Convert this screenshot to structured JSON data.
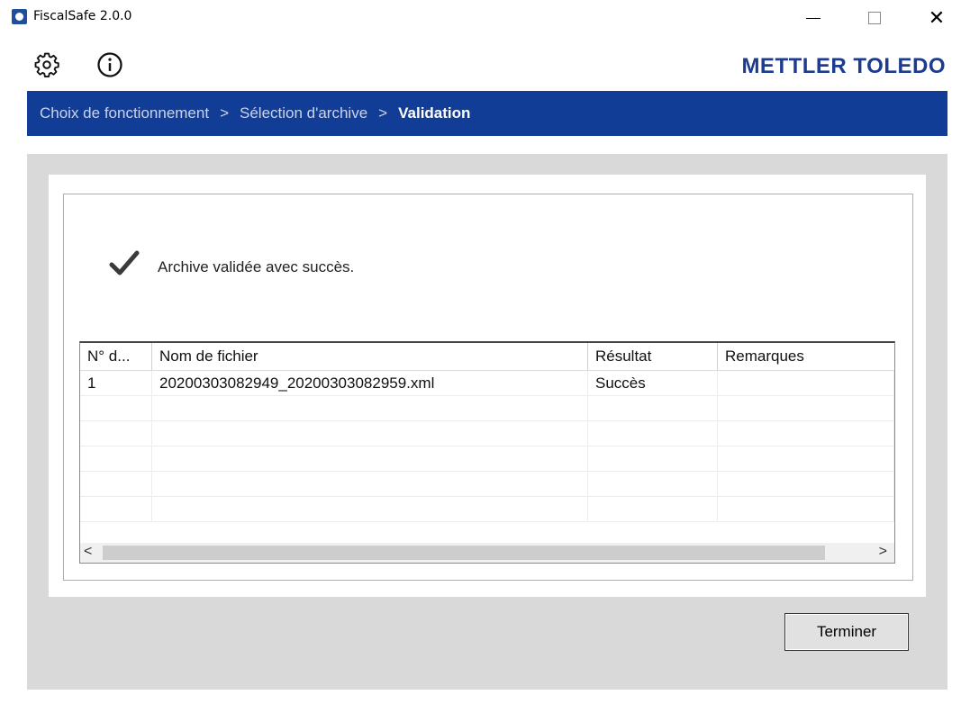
{
  "window": {
    "title": "FiscalSafe 2.0.0",
    "minimize": "—",
    "maximize": "☐",
    "close": "✕"
  },
  "toolbar": {
    "settings_icon": "gear-icon",
    "info_icon": "info-icon",
    "brand": "METTLER TOLEDO"
  },
  "breadcrumb": {
    "items": [
      "Choix de fonctionnement",
      "Sélection d'archive",
      "Validation"
    ],
    "separator": ">"
  },
  "result": {
    "icon": "checkmark-icon",
    "message": "Archive validée avec succès."
  },
  "table": {
    "columns": [
      "N° d...",
      "Nom de fichier",
      "Résultat",
      "Remarques"
    ],
    "rows": [
      [
        "1",
        "20200303082949_20200303082959.xml",
        "Succès",
        ""
      ]
    ]
  },
  "scrollbar": {
    "left_arrow": "<",
    "right_arrow": ">"
  },
  "actions": {
    "finish_label": "Terminer"
  },
  "colors": {
    "brand_blue": "#1d3c8f",
    "breadcrumb_bg": "#123d96"
  }
}
